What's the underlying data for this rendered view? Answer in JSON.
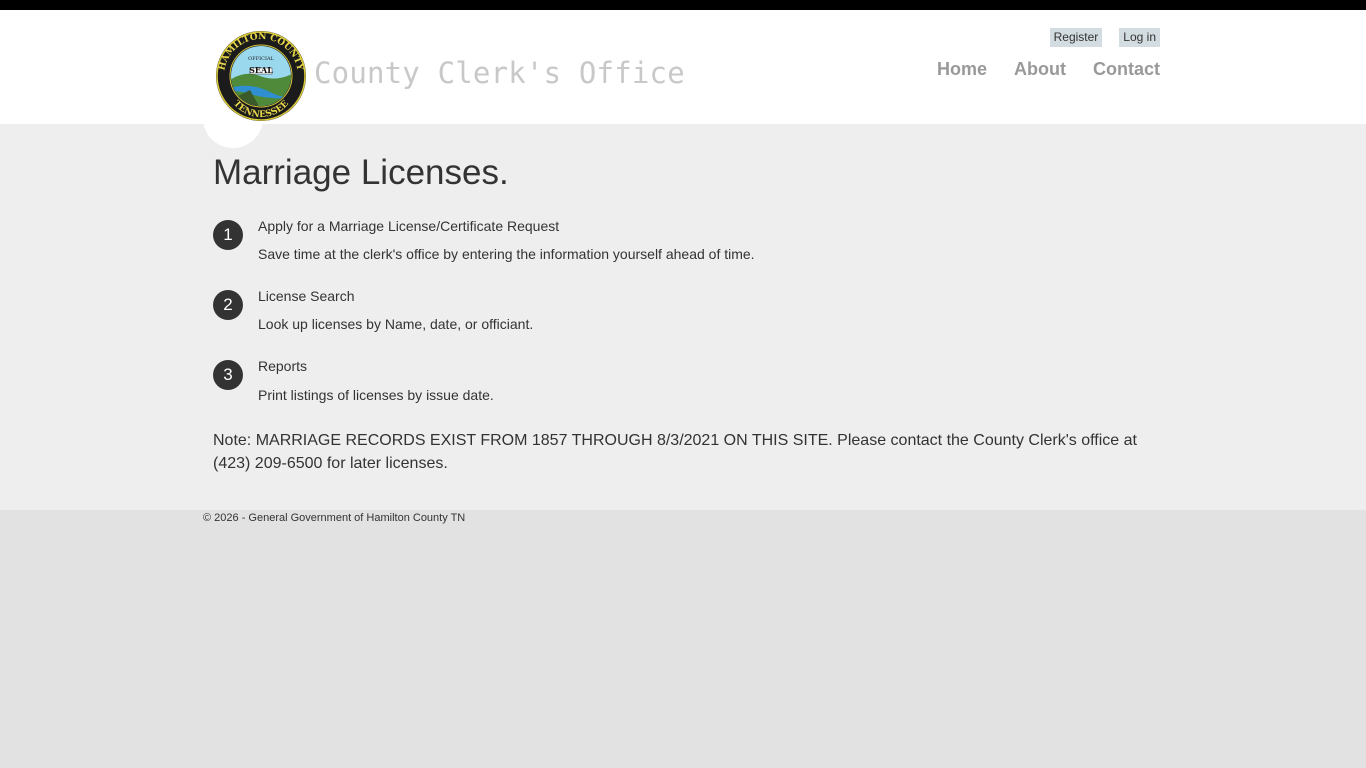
{
  "header": {
    "site_title": "County Clerk's Office",
    "seal": {
      "top_text": "HAMILTON COUNTY",
      "middle_small": "OFFICIAL",
      "middle_large": "SEAL",
      "bottom_text": "TENNESSEE"
    },
    "login": {
      "register_label": "Register",
      "login_label": "Log in"
    },
    "nav": {
      "home": "Home",
      "about": "About",
      "contact": "Contact"
    }
  },
  "main": {
    "title": "Marriage Licenses.",
    "steps": [
      {
        "number": "1",
        "title": "Apply for a Marriage License/Certificate Request",
        "description": "Save time at the clerk's office by entering the information yourself ahead of time."
      },
      {
        "number": "2",
        "title": "License Search",
        "description": "Look up licenses by Name, date, or officiant."
      },
      {
        "number": "3",
        "title": "Reports",
        "description": "Print listings of licenses by issue date."
      }
    ],
    "note": "Note: MARRIAGE RECORDS EXIST FROM 1857 THROUGH 8/3/2021 ON THIS SITE. Please contact the County Clerk's office at (423) 209-6500 for later licenses."
  },
  "footer": {
    "copyright": "© 2026 - General Government of Hamilton County TN"
  },
  "colors": {
    "header_bg": "#ffffff",
    "main_bg": "#eeeeee",
    "footer_bg": "#e2e2e2",
    "nav_text": "#999999",
    "site_title": "#c8c8c8",
    "step_badge": "#333333",
    "login_button_bg": "#d3dce0"
  }
}
